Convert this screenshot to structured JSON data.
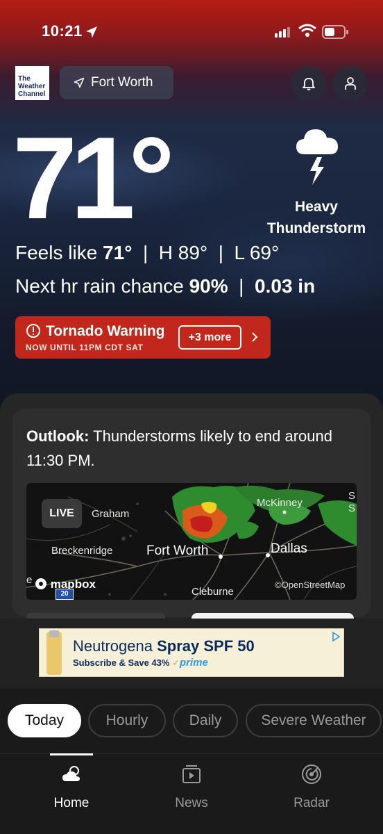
{
  "status_bar": {
    "time": "10:21"
  },
  "header": {
    "logo_lines": [
      "The",
      "Weather",
      "Channel"
    ],
    "location": "Fort Worth"
  },
  "current": {
    "temperature": "71°",
    "condition_line1": "Heavy",
    "condition_line2": "Thunderstorm",
    "feels_like_label": "Feels like",
    "feels_like": "71°",
    "high": "H 89°",
    "low": "L 69°",
    "rain_label": "Next hr rain chance",
    "rain_chance": "90%",
    "rain_amount": "0.03 in"
  },
  "alert": {
    "title": "Tornado Warning",
    "subtitle": "NOW UNTIL 11PM CDT SAT",
    "more_label": "+3 more",
    "color": "#c1271a"
  },
  "outlook": {
    "label": "Outlook:",
    "text": "Thunderstorms likely to end around 11:30 PM."
  },
  "map": {
    "live_label": "LIVE",
    "places": {
      "graham": "Graham",
      "mckinney": "McKinney",
      "breckenridge": "Breckenridge",
      "fort_worth": "Fort Worth",
      "dallas": "Dallas",
      "cleburne": "Cleburne"
    },
    "edge_left": "e",
    "edge_right_1": "S",
    "edge_right_2": "S",
    "brand": "mapbox",
    "attribution": "©OpenStreetMap",
    "highway_shield": "20"
  },
  "ad": {
    "brand": "Neutrogena",
    "product": "Spray SPF 50",
    "offer": "Subscribe & Save 43%",
    "prime": "prime",
    "check": "✓"
  },
  "tabs": [
    "Today",
    "Hourly",
    "Daily",
    "Severe Weather"
  ],
  "nav": [
    {
      "label": "Home",
      "icon": "cloud-sun-icon"
    },
    {
      "label": "News",
      "icon": "video-icon"
    },
    {
      "label": "Radar",
      "icon": "radar-icon"
    }
  ]
}
